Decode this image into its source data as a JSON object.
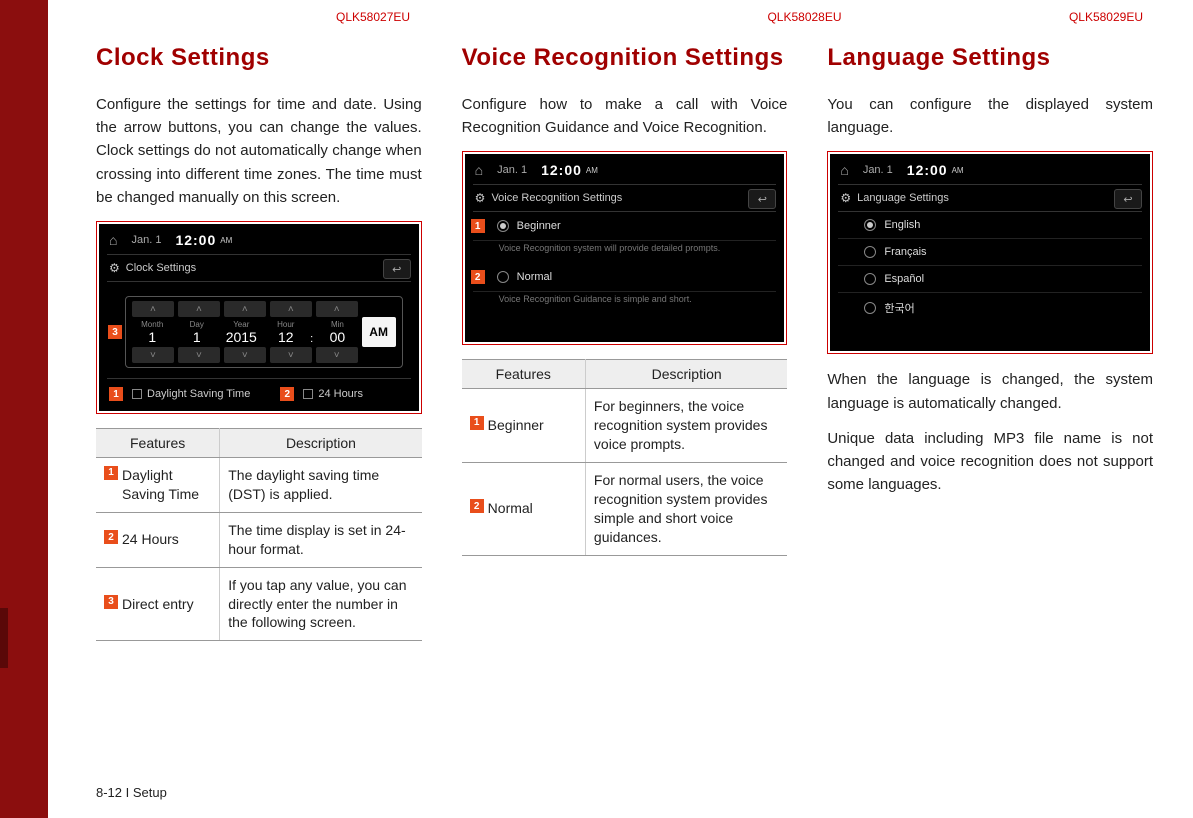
{
  "codes": [
    "QLK58027EU",
    "QLK58028EU",
    "QLK58029EU"
  ],
  "footer": "8-12 I Setup",
  "col1": {
    "title": "Clock Settings",
    "desc": "Configure the settings for time and date. Using the arrow buttons, you can change the values. Clock settings do not automatically change when crossing into different time zones. The time must be changed manually on this screen.",
    "shot": {
      "date": "Jan. 1",
      "time": "12:00",
      "ampm_small": "AM",
      "screen_title": "Clock Settings",
      "cols": [
        {
          "label": "Month",
          "val": "1"
        },
        {
          "label": "Day",
          "val": "1"
        },
        {
          "label": "Year",
          "val": "2015"
        },
        {
          "label": "Hour",
          "val": "12"
        },
        {
          "label": "Min",
          "val": "00"
        }
      ],
      "ampm_cell": "AM",
      "chk1": "Daylight Saving Time",
      "chk2": "24 Hours",
      "b1": "1",
      "b2": "2",
      "b3": "3"
    },
    "table": {
      "h1": "Features",
      "h2": "Description",
      "rows": [
        {
          "n": "1",
          "f": "Daylight Saving Time",
          "d": "The daylight saving time (DST) is applied."
        },
        {
          "n": "2",
          "f": "24 Hours",
          "d": "The time display is set in 24-hour format."
        },
        {
          "n": "3",
          "f": "Direct entry",
          "d": "If you tap any value, you can directly enter the number in the following screen."
        }
      ]
    }
  },
  "col2": {
    "title": "Voice Recognition Settings",
    "desc": "Configure how to make a call with Voice Recognition Guidance and Voice Recognition.",
    "shot": {
      "date": "Jan. 1",
      "time": "12:00",
      "ampm_small": "AM",
      "screen_title": "Voice Recognition Settings",
      "opt1": "Beginner",
      "sub1": "Voice Recognition system will provide detailed prompts.",
      "opt2": "Normal",
      "sub2": "Voice Recognition Guidance is simple and short.",
      "b1": "1",
      "b2": "2"
    },
    "table": {
      "h1": "Features",
      "h2": "Description",
      "rows": [
        {
          "n": "1",
          "f": "Beginner",
          "d": "For beginners, the voice recognition system provides voice prompts."
        },
        {
          "n": "2",
          "f": "Normal",
          "d": "For normal users, the voice recognition system provides simple and short voice guidances."
        }
      ]
    }
  },
  "col3": {
    "title": "Language Settings",
    "desc1": "You can configure the displayed system language.",
    "shot": {
      "date": "Jan. 1",
      "time": "12:00",
      "ampm_small": "AM",
      "screen_title": "Language Settings",
      "opts": [
        "English",
        "Français",
        "Español",
        "한국어"
      ]
    },
    "desc2": "When the language is changed, the system language is automatically changed.",
    "desc3": "Unique data including MP3 file name is not changed and voice recognition does not support some languages."
  }
}
